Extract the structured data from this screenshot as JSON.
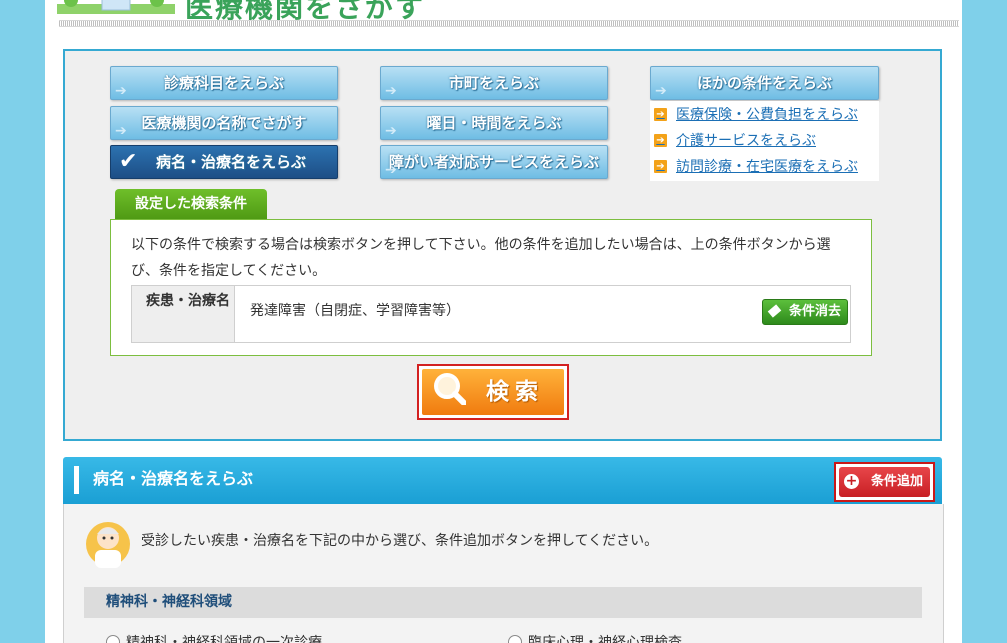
{
  "header": {
    "title": "医療機関をさがす"
  },
  "conditions": {
    "buttons": [
      {
        "label": "診療科目をえらぶ",
        "active": false
      },
      {
        "label": "市町をえらぶ",
        "active": false
      },
      {
        "label": "ほかの条件をえらぶ",
        "active": false
      },
      {
        "label": "医療機関の名称でさがす",
        "active": false
      },
      {
        "label": "曜日・時間をえらぶ",
        "active": false
      },
      {
        "label": "病名・治療名をえらぶ",
        "active": true
      },
      {
        "label": "障がい者対応サービスをえらぶ",
        "active": false
      }
    ],
    "other_links": [
      "医療保険・公費負担をえらぶ",
      "介護サービスをえらぶ",
      "訪問診療・在宅医療をえらぶ"
    ]
  },
  "set_conditions": {
    "tab_label": "設定した検索条件",
    "description": "以下の条件で検索する場合は検索ボタンを押して下さい。他の条件を追加したい場合は、上の条件ボタンから選び、条件を指定してください。",
    "row_header": "疾患・治療名",
    "row_value": "発達障害（自閉症、学習障害等）",
    "clear_label": "条件消去"
  },
  "search_label": "検索",
  "section": {
    "title": "病名・治療名をえらぶ",
    "add_label": "条件追加",
    "instruction": "受診したい疾患・治療名を下記の中から選び、条件追加ボタンを押してください。",
    "group_title": "精神科・神経科領域",
    "options": [
      "精神科・神経科領域の一次診療",
      "臨床心理・神経心理検査"
    ]
  },
  "colors": {
    "page_bg": "#7fd0ea",
    "accent_blue": "#35a9d2",
    "active_button": "#1d4e86",
    "green_tab": "#4f9a14",
    "search_orange": "#f07b0f",
    "highlight_red": "#d32121"
  }
}
